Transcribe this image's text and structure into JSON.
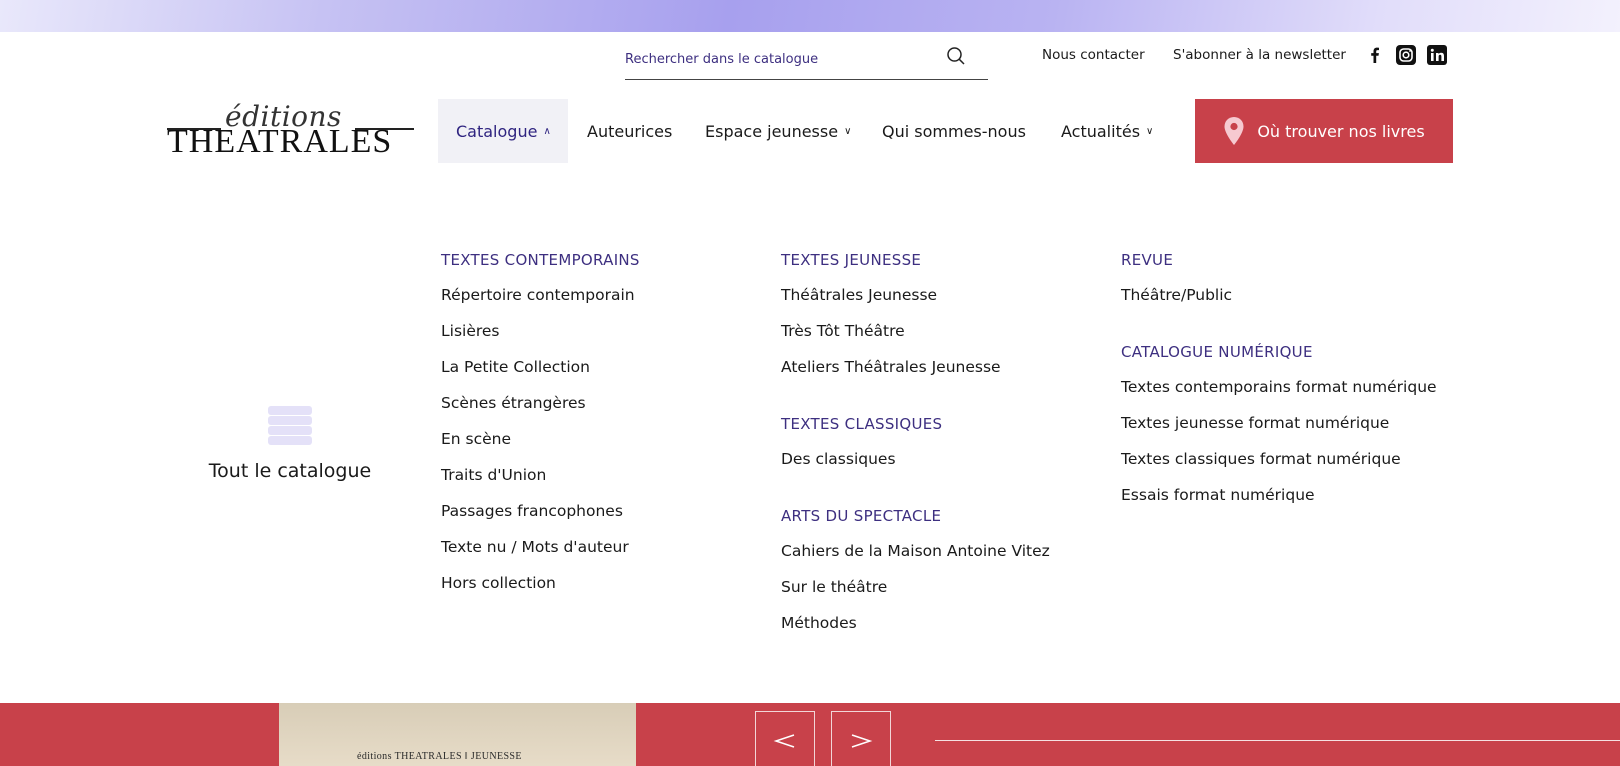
{
  "search": {
    "placeholder": "Rechercher dans le catalogue"
  },
  "utility": {
    "contact": "Nous contacter",
    "newsletter": "S'abonner à la newsletter"
  },
  "logo": {
    "small": "éditions",
    "big": "THEATRALES"
  },
  "nav": {
    "items": [
      {
        "label": "Catalogue",
        "caret": "∧"
      },
      {
        "label": "Auteurices",
        "caret": ""
      },
      {
        "label": "Espace jeunesse",
        "caret": "∨"
      },
      {
        "label": "Qui sommes-nous",
        "caret": ""
      },
      {
        "label": "Actualités",
        "caret": "∨"
      }
    ],
    "cta": "Où trouver nos livres"
  },
  "menu": {
    "all_catalogue": "Tout le catalogue",
    "col1": {
      "heading": "TEXTES CONTEMPORAINS",
      "links": [
        "Répertoire contemporain",
        "Lisières",
        "La Petite Collection",
        "Scènes étrangères",
        "En scène",
        "Traits d'Union",
        "Passages francophones",
        "Texte nu / Mots d'auteur",
        "Hors collection"
      ]
    },
    "col2": {
      "sections": [
        {
          "heading": "TEXTES JEUNESSE",
          "links": [
            "Théâtrales Jeunesse",
            "Très Tôt Théâtre",
            "Ateliers Théâtrales Jeunesse"
          ]
        },
        {
          "heading": "TEXTES CLASSIQUES",
          "links": [
            "Des classiques"
          ]
        },
        {
          "heading": "ARTS DU SPECTACLE",
          "links": [
            "Cahiers de la Maison Antoine Vitez",
            "Sur le théâtre",
            "Méthodes"
          ]
        }
      ]
    },
    "col3": {
      "sections": [
        {
          "heading": "REVUE",
          "links": [
            "Théâtre/Public"
          ]
        },
        {
          "heading": "CATALOGUE NUMÉRIQUE",
          "links": [
            "Textes contemporains format numérique",
            "Textes jeunesse format numérique",
            "Textes classiques format numérique",
            "Essais format numérique"
          ]
        }
      ]
    }
  },
  "carousel": {
    "cover_text": "éditions THEATRALES ‖ JEUNESSE",
    "prev": "<",
    "next": ">"
  },
  "colors": {
    "accent": "#c8414a",
    "heading": "#3d2f80"
  }
}
